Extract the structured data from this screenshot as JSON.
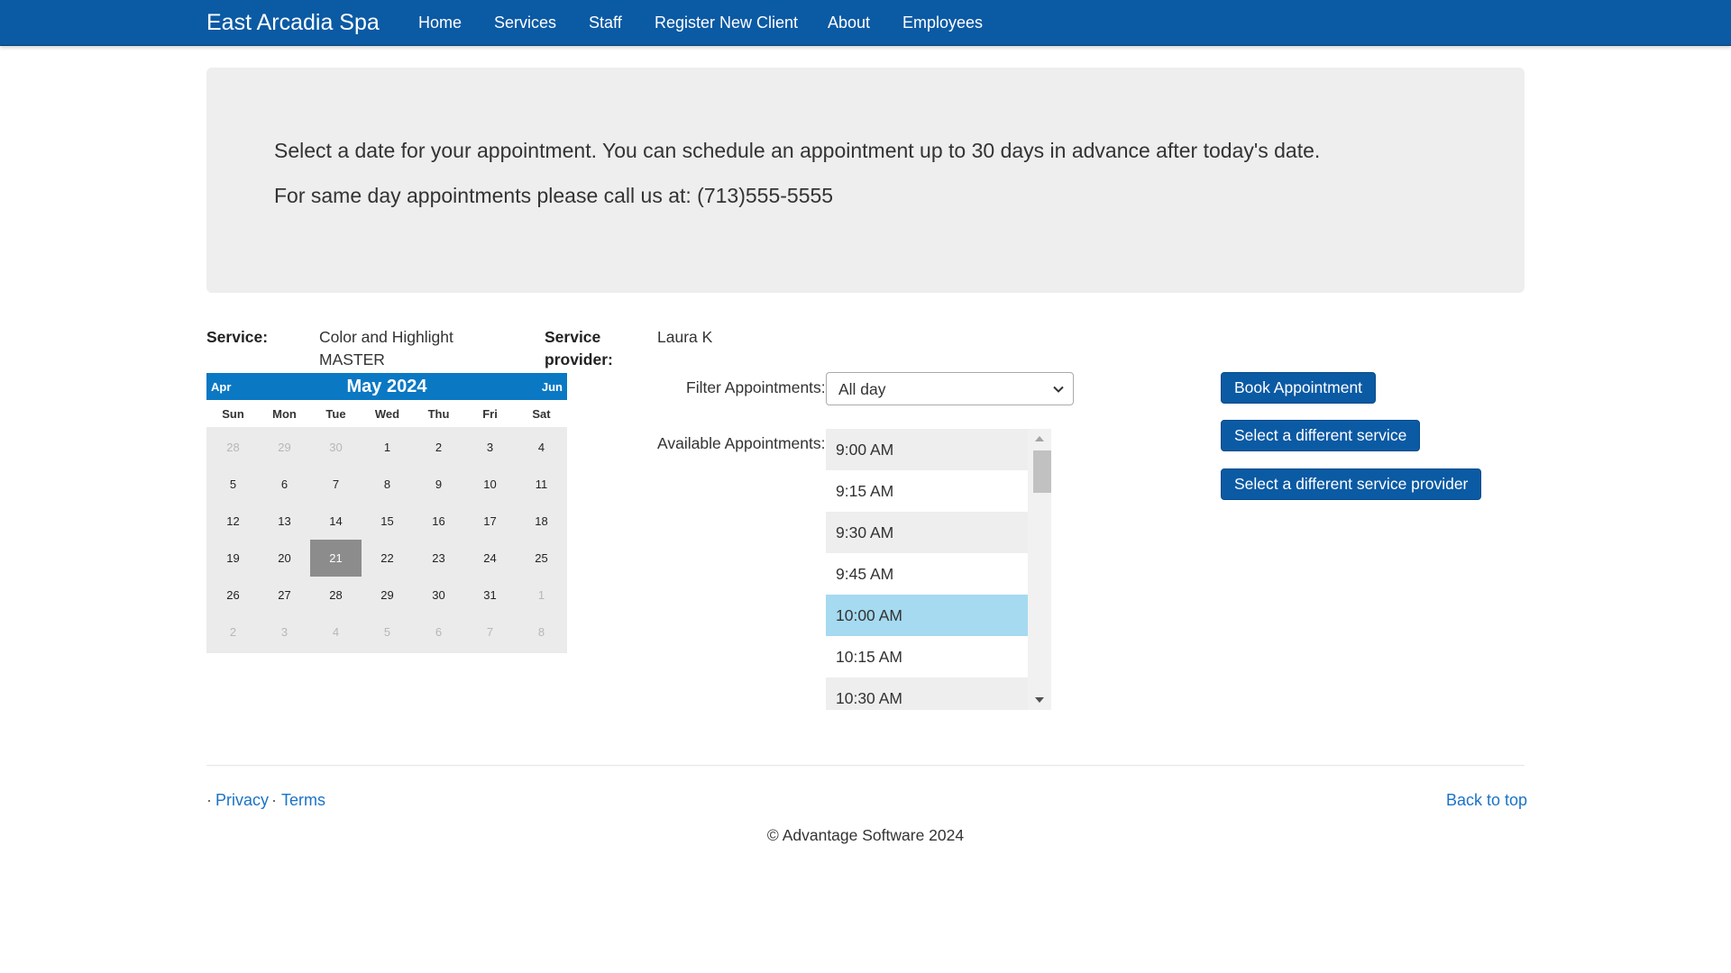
{
  "navbar": {
    "brand": "East Arcadia Spa",
    "links": [
      "Home",
      "Services",
      "Staff",
      "Register New Client",
      "About",
      "Employees"
    ]
  },
  "jumbotron": {
    "line1": "Select a date for your appointment. You can schedule an appointment up to 30 days in advance after today's date.",
    "line2": "For same day appointments please call us at: (713)555-5555"
  },
  "info": {
    "service_label": "Service:",
    "service_value_line1": "Color and Highlight",
    "service_value_line2": "MASTER",
    "provider_label_line1": "Service",
    "provider_label_line2": "provider:",
    "provider_value": "Laura K"
  },
  "calendar": {
    "prev": "Apr",
    "title": "May 2024",
    "next": "Jun",
    "days_of_week": [
      "Sun",
      "Mon",
      "Tue",
      "Wed",
      "Thu",
      "Fri",
      "Sat"
    ],
    "weeks": [
      [
        "28",
        "29",
        "30",
        "1",
        "2",
        "3",
        "4"
      ],
      [
        "5",
        "6",
        "7",
        "8",
        "9",
        "10",
        "11"
      ],
      [
        "12",
        "13",
        "14",
        "15",
        "16",
        "17",
        "18"
      ],
      [
        "19",
        "20",
        "21",
        "22",
        "23",
        "24",
        "25"
      ],
      [
        "26",
        "27",
        "28",
        "29",
        "30",
        "31",
        "1"
      ],
      [
        "2",
        "3",
        "4",
        "5",
        "6",
        "7",
        "8"
      ]
    ],
    "selected_day": "21"
  },
  "filter": {
    "label": "Filter Appointments:",
    "value": "All day"
  },
  "appointments": {
    "label": "Available Appointments:",
    "slots": [
      "9:00 AM",
      "9:15 AM",
      "9:30 AM",
      "9:45 AM",
      "10:00 AM",
      "10:15 AM",
      "10:30 AM"
    ],
    "selected": "10:00 AM"
  },
  "buttons": {
    "book": "Book Appointment",
    "different_service": "Select a different service",
    "different_provider": "Select a different service provider"
  },
  "footer": {
    "separator": "·",
    "privacy": "Privacy",
    "terms": "Terms",
    "back_to_top": "Back to top",
    "copyright": "© Advantage Software 2024"
  },
  "colors": {
    "navbar": "#0b5aa4",
    "calendar_header": "#0b78c4",
    "selected_slot": "#a5daf0",
    "selected_day": "#8c8c8c",
    "link": "#1a73c7"
  }
}
